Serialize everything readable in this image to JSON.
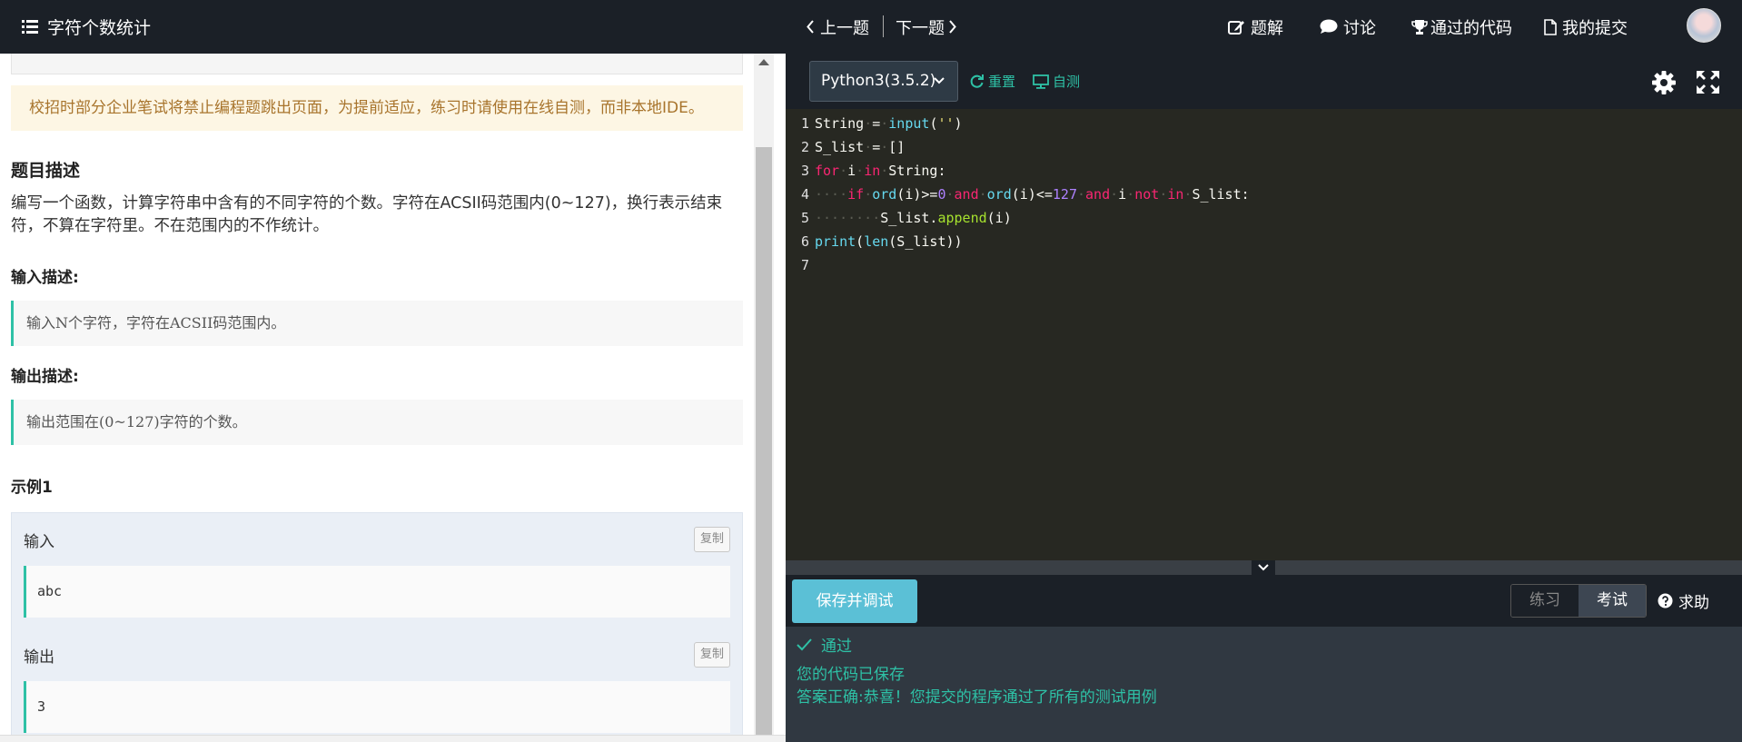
{
  "left": {
    "title": "字符个数统计",
    "notice": "校招时部分企业笔试将禁止编程题跳出页面，为提前适应，练习时请使用在线自测，而非本地IDE。",
    "description_heading": "题目描述",
    "description_line1": "编写一个函数，计算字符串中含有的不同字符的个数。字符在ACSII码范围内(0~127)，换行表示结束",
    "description_line2": "符，不算在字符里。不在范围内的不作统计。",
    "input_heading": "输入描述:",
    "input_desc": "输入N个字符，字符在ACSII码范围内。",
    "output_heading": "输出描述:",
    "output_desc": "输出范围在(0~127)字符的个数。",
    "example_heading": "示例1",
    "example": {
      "input_label": "输入",
      "input_value": "abc",
      "output_label": "输出",
      "output_value": "3",
      "copy_label": "复制"
    }
  },
  "header": {
    "prev": "上一题",
    "next": "下一题",
    "solution": "题解",
    "discuss": "讨论",
    "passed_code": "通过的代码",
    "my_submissions": "我的提交"
  },
  "toolbar": {
    "language": "Python3(3.5.2)",
    "reset": "重置",
    "self_test": "自测"
  },
  "editor": {
    "line_numbers": [
      "1",
      "2",
      "3",
      "4",
      "5",
      "6",
      "7"
    ]
  },
  "bottom": {
    "save_debug": "保存并调试",
    "mode_practice": "练习",
    "mode_exam": "考试",
    "help": "求助"
  },
  "result": {
    "status": "通过",
    "saved": "您的代码已保存",
    "message": "答案正确:恭喜！您提交的程序通过了所有的测试用例"
  },
  "colors": {
    "accent": "#2ec1a6",
    "header_bg": "#1b2027",
    "editor_bg": "#272822",
    "notice_bg": "#fdf6e4",
    "save_button": "#5bc0d6"
  }
}
